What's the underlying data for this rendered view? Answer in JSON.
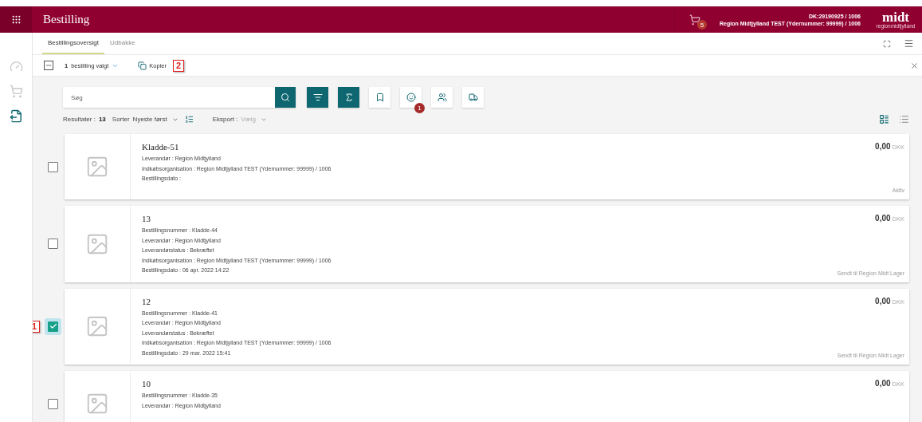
{
  "header": {
    "title": "Bestilling",
    "cart_badge": "5",
    "account_lines": [
      "DK:29190925 / 1006",
      "Region Midtjylland TEST (Ydernummer: 99999) / 1006"
    ],
    "logo": "midt",
    "logo_sub": "regionmidtjylland"
  },
  "rail": [
    {
      "kind": "dashboard",
      "selected": false
    },
    {
      "kind": "cart",
      "selected": false
    },
    {
      "kind": "order",
      "selected": true
    }
  ],
  "tabs": [
    {
      "label": "Bestillingsoversigt",
      "selected": true
    },
    {
      "label": "Udbakke",
      "selected": false
    }
  ],
  "selection_bar": {
    "indeterminate": true,
    "count": "1",
    "label": "bestilling valgt",
    "copy": "Kopier",
    "callout": "2"
  },
  "search": {
    "placeholder": "Søg"
  },
  "tools": [
    {
      "kind": "filter",
      "primary": true
    },
    {
      "kind": "sum",
      "primary": true
    },
    {
      "kind": "bookmark",
      "primary": false
    },
    {
      "kind": "face",
      "primary": false,
      "badge": "1"
    },
    {
      "kind": "people",
      "primary": false
    },
    {
      "kind": "truck",
      "primary": false
    }
  ],
  "results": {
    "label": "Resultater :",
    "count": "13",
    "sort_label": "Sorter",
    "sort_value": "Nyeste først",
    "export_label": "Eksport :",
    "export_value": "Vælg"
  },
  "views": [
    {
      "kind": "cards",
      "selected": true
    },
    {
      "kind": "list",
      "selected": false
    }
  ],
  "orders": [
    {
      "title": "Kladde-51",
      "checked": false,
      "details": [
        "Leverandør : Region Midtjylland",
        "Indkøbsorganisation : Region Midtjylland TEST (Ydernummer: 99999) / 1006",
        "Bestillingsdato :"
      ],
      "amount": "0,00",
      "currency": "DKK",
      "status": "Aktiv"
    },
    {
      "title": "13",
      "checked": false,
      "details": [
        "Bestillingsnummer : Kladde-44",
        "Leverandør : Region Midtjylland",
        "Leverandørstatus : Bekræftet",
        "Indkøbsorganisation : Region Midtjylland TEST (Ydernummer: 99999) / 1006",
        "Bestillingsdato : 06 apr. 2022 14:22"
      ],
      "amount": "0,00",
      "currency": "DKK",
      "status": "Sendt til Region Midt Lager"
    },
    {
      "title": "12",
      "checked": true,
      "callout": "1",
      "details": [
        "Bestillingsnummer : Kladde-41",
        "Leverandør : Region Midtjylland",
        "Leverandørstatus : Bekræftet",
        "Indkøbsorganisation : Region Midtjylland TEST (Ydernummer: 99999) / 1006",
        "Bestillingsdato : 29 mar. 2022 15:41"
      ],
      "amount": "0,00",
      "currency": "DKK",
      "status": "Sendt til Region Midt Lager"
    },
    {
      "title": "10",
      "checked": false,
      "details": [
        "Bestillingsnummer : Kladde-35",
        "Leverandør : Region Midtjylland"
      ],
      "amount": "0,00",
      "currency": "DKK"
    }
  ]
}
